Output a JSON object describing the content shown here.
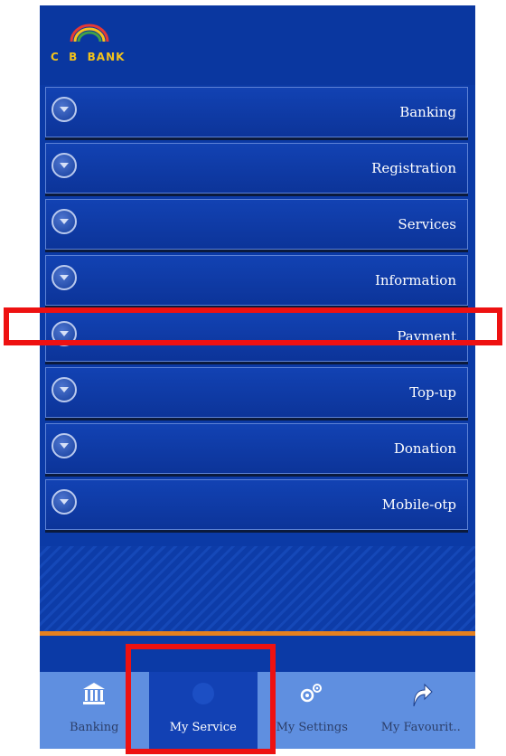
{
  "header": {
    "logo_text": "C  B  BANK"
  },
  "menu": {
    "items": [
      {
        "label": "Banking"
      },
      {
        "label": "Registration"
      },
      {
        "label": "Services"
      },
      {
        "label": "Information"
      },
      {
        "label": "Payment"
      },
      {
        "label": "Top-up"
      },
      {
        "label": "Donation"
      },
      {
        "label": "Mobile-otp"
      }
    ]
  },
  "tabbar": {
    "tabs": [
      {
        "label": "Banking",
        "icon": "bank-icon"
      },
      {
        "label": "My Service",
        "icon": "service-icon"
      },
      {
        "label": "My Settings",
        "icon": "gears-icon"
      },
      {
        "label": "My Favourit..",
        "icon": "share-arrow-icon"
      }
    ],
    "active_tab": "My Service"
  },
  "colors": {
    "background": "#0b3aa6",
    "tabbar": "#5f8fe0",
    "accent_stripe": "#e5801f",
    "highlight": "#ee1111"
  }
}
